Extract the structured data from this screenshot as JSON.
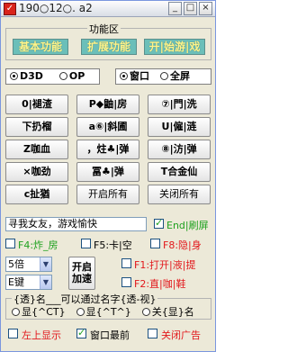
{
  "window": {
    "title": "190○12○. a2",
    "app_icon_glyph": "✓",
    "min_glyph": "_",
    "max_glyph": "□",
    "close_glyph": "×"
  },
  "function_area": {
    "legend": "功能区",
    "basic_label": "基本功能",
    "extended_label": "扩展功能",
    "start_game_label": "开|始游|戏",
    "button_color": "#6bbfb9",
    "button_text_color": "#fff58a"
  },
  "render_mode": {
    "d3d_label": "D3D",
    "op_label": "OP",
    "d3d_selected": true,
    "op_selected": false
  },
  "display_mode": {
    "window_label": "窗口",
    "fullscreen_label": "全屏",
    "window_selected": true,
    "fullscreen_selected": false
  },
  "grid_buttons": [
    "0|褪渣",
    "P◆鼬|房",
    "⑦|門|洗",
    "下扔榴",
    "a⑥|斜圃",
    "U|僱|涟",
    "Z咖血",
    "，炷♣|弹",
    "⑧|汸|弹",
    "×咖劲",
    "冨♣|弹",
    "T合金仙",
    "c扯猶",
    "开启所有",
    "关闭所有"
  ],
  "chat": {
    "message_value": "寻我女友，游戏愉快",
    "end_label": "End|刷屏",
    "end_checked": true
  },
  "hotkeys": {
    "f4_label": "F4:炸_房",
    "f5_label": "F5:卡|空",
    "f8_label": "F8:隐|身",
    "f4_checked": false,
    "f5_checked": false,
    "f8_checked": false
  },
  "speed": {
    "multiplier_value": "5倍",
    "key_value": "E键",
    "toggle_label_line1": "开启",
    "toggle_label_line2": "加速"
  },
  "extra_hotkeys": {
    "f1_label": "F1:打开|液|提",
    "f2_label": "F2:直|咖|鞋",
    "f1_checked": false,
    "f2_checked": false
  },
  "nickname": {
    "legend": "{透}名___可以通过名字{透-视}",
    "show_ct_label": "显{^CT}",
    "show_t_label": "显{^T^}",
    "close_label": "关{显}名",
    "selected": "none"
  },
  "bottom": {
    "top_left_label": "左上显示",
    "window_top_label": "窗口最前",
    "close_ads_label": "关闭广告",
    "top_left_checked": false,
    "window_top_checked": true,
    "close_ads_checked": false
  }
}
